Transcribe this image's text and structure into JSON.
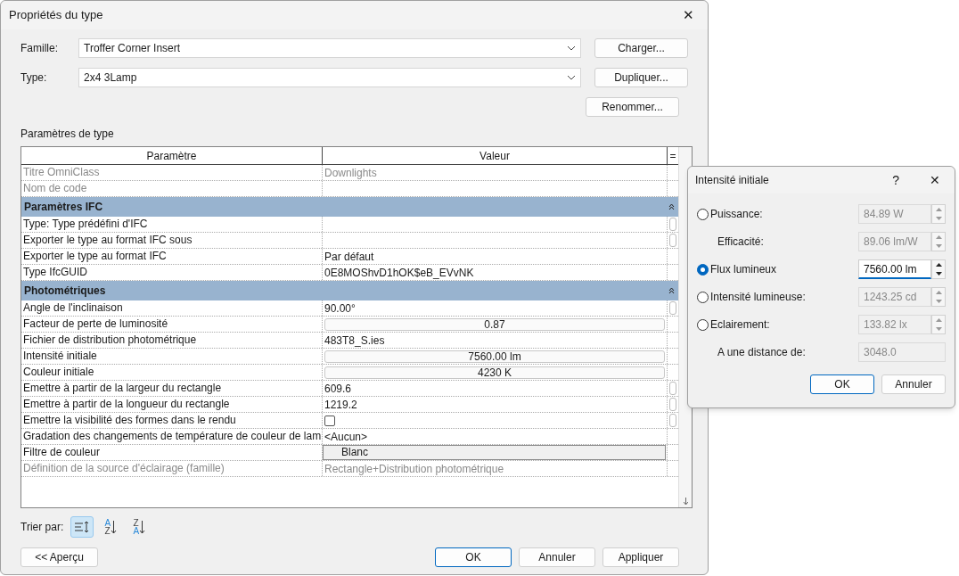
{
  "window": {
    "title": "Propriétés du type",
    "close": "✕"
  },
  "fields": [
    {
      "label": "Famille:",
      "value": "Troffer Corner Insert",
      "button": "Charger..."
    },
    {
      "label": "Type:",
      "value": "2x4 3Lamp",
      "button": "Dupliquer..."
    }
  ],
  "rename_button": "Renommer...",
  "section_label": "Paramètres de type",
  "table": {
    "columns": [
      "Paramètre",
      "Valeur",
      "="
    ],
    "rows": [
      {
        "kind": "text",
        "name": "Titre OmniClass",
        "value": "Downlights",
        "disabled": true,
        "side_button": false
      },
      {
        "kind": "text",
        "name": "Nom de code",
        "value": "",
        "disabled": true,
        "side_button": false
      },
      {
        "kind": "group",
        "name": "Paramètres IFC",
        "expanded": true
      },
      {
        "kind": "text",
        "name": "Type: Type prédéfini d'IFC",
        "value": "",
        "disabled": false,
        "side_button": true
      },
      {
        "kind": "text",
        "name": "Exporter le type au format IFC sous",
        "value": "",
        "disabled": false,
        "side_button": true
      },
      {
        "kind": "text",
        "name": "Exporter le type au format IFC",
        "value": "Par défaut",
        "disabled": false,
        "side_button": false
      },
      {
        "kind": "text",
        "name": "Type IfcGUID",
        "value": "0E8MOShvD1hOK$eB_EVvNK",
        "disabled": false,
        "side_button": false
      },
      {
        "kind": "group",
        "name": "Photométriques",
        "expanded": true
      },
      {
        "kind": "text",
        "name": "Angle de l'inclinaison",
        "value": "90.00°",
        "disabled": false,
        "side_button": true
      },
      {
        "kind": "button",
        "name": "Facteur de perte de luminosité",
        "value": "0.87",
        "disabled": false,
        "side_button": false
      },
      {
        "kind": "text",
        "name": "Fichier de distribution photométrique",
        "value": "483T8_S.ies",
        "disabled": false,
        "side_button": false
      },
      {
        "kind": "button",
        "name": "Intensité initiale",
        "value": "7560.00 lm",
        "disabled": false,
        "side_button": false
      },
      {
        "kind": "button",
        "name": "Couleur initiale",
        "value": "4230 K",
        "disabled": false,
        "side_button": false
      },
      {
        "kind": "text",
        "name": "Emettre à partir de la largeur du rectangle",
        "value": "609.6",
        "disabled": false,
        "side_button": true
      },
      {
        "kind": "text",
        "name": "Emettre à partir de la longueur du rectangle",
        "value": "1219.2",
        "disabled": false,
        "side_button": true
      },
      {
        "kind": "checkbox",
        "name": "Emettre la visibilité des formes dans le rendu",
        "checked": false,
        "disabled": false,
        "side_button": true
      },
      {
        "kind": "text",
        "name": "Gradation des changements de température de couleur de lam",
        "value": "<Aucun>",
        "disabled": false,
        "side_button": false
      },
      {
        "kind": "color",
        "name": "Filtre de couleur",
        "value": "Blanc",
        "disabled": false,
        "side_button": false
      },
      {
        "kind": "text",
        "name": "Définition de la source d'éclairage (famille)",
        "value": "Rectangle+Distribution photométrique",
        "disabled": true,
        "side_button": false
      }
    ]
  },
  "sort": {
    "label": "Trier par:",
    "buttons": [
      {
        "kind": "category",
        "selected": true
      },
      {
        "kind": "letters",
        "letters": [
          "A",
          "Z"
        ],
        "selected": false
      },
      {
        "kind": "letters",
        "letters": [
          "Z",
          "A"
        ],
        "selected": false
      }
    ]
  },
  "preview_button": "<< Aperçu",
  "buttons": [
    {
      "label": "OK",
      "default": true
    },
    {
      "label": "Annuler",
      "default": false
    },
    {
      "label": "Appliquer",
      "default": false
    }
  ],
  "popup": {
    "title": "Intensité initiale",
    "help": "?",
    "close": "✕",
    "options": [
      {
        "kind": "radio",
        "label": "Puissance:",
        "value": "84.89 W",
        "selected": false
      },
      {
        "kind": "sub",
        "label": "Efficacité:",
        "value": "89.06 lm/W",
        "spin": true
      },
      {
        "kind": "radio",
        "label": "Flux lumineux",
        "value": "7560.00 lm",
        "selected": true
      },
      {
        "kind": "radio",
        "label": "Intensité lumineuse:",
        "value": "1243.25 cd",
        "selected": false
      },
      {
        "kind": "radio",
        "label": "Eclairement:",
        "value": "133.82 lx",
        "selected": false
      },
      {
        "kind": "sub",
        "label": "A une distance de:",
        "value": "3048.0",
        "spin": false
      }
    ],
    "buttons": [
      {
        "label": "OK",
        "default": true
      },
      {
        "label": "Annuler",
        "default": false
      }
    ]
  }
}
